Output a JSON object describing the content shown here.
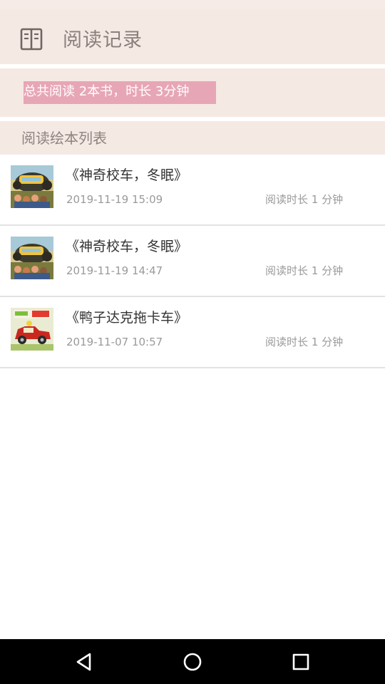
{
  "header": {
    "title": "阅读记录",
    "icon": "open-book-icon"
  },
  "summary": {
    "text": "总共阅读 2本书，时长  3分钟"
  },
  "list": {
    "heading": "阅读绘本列表",
    "items": [
      {
        "title": "《神奇校车，冬眠》",
        "date": "2019-11-19 15:09",
        "duration": "阅读时长 1 分钟",
        "cover": "book-cover-magic-school-bus"
      },
      {
        "title": "《神奇校车，冬眠》",
        "date": "2019-11-19 14:47",
        "duration": "阅读时长 1 分钟",
        "cover": "book-cover-magic-school-bus"
      },
      {
        "title": "《鸭子达克拖卡车》",
        "date": "2019-11-07 10:57",
        "duration": "阅读时长 1 分钟",
        "cover": "book-cover-duck-truck"
      }
    ]
  },
  "nav": {
    "back_icon": "back-triangle-icon",
    "home_icon": "home-circle-icon",
    "recents_icon": "recents-square-icon"
  },
  "colors": {
    "header_bg": "#f5e9e3",
    "summary_pill": "#e7a6b6",
    "title_text": "#8a7f7c"
  }
}
